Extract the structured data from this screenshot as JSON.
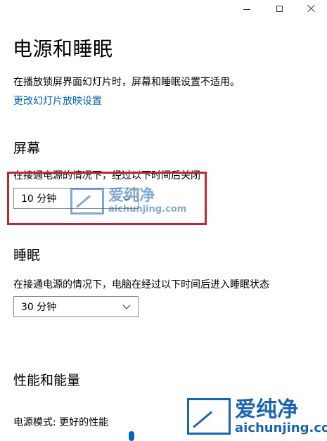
{
  "page": {
    "title": "电源和睡眠",
    "info": "在播放锁屏界面幻灯片时，屏幕和睡眠设置不适用。",
    "link": "更改幻灯片放映设置"
  },
  "screen": {
    "heading": "屏幕",
    "description": "在接通电源的情况下，经过以下时间后关闭",
    "value": "10 分钟"
  },
  "sleep": {
    "heading": "睡眠",
    "description": "在接通电源的情况下，电脑在经过以下时间后进入睡眠状态",
    "value": "30 分钟"
  },
  "power": {
    "heading": "性能和能量",
    "mode": "电源模式: 更好的性能"
  },
  "watermark": {
    "name": "爱纯净",
    "url": "aichunjing.com"
  },
  "colors": {
    "link": "#0066b4",
    "highlight": "#c0262d",
    "watermark": "#1a64b4"
  },
  "icons": [
    "minimize-icon",
    "maximize-icon",
    "close-icon",
    "chevron-down-icon",
    "watermark-logo-icon"
  ]
}
